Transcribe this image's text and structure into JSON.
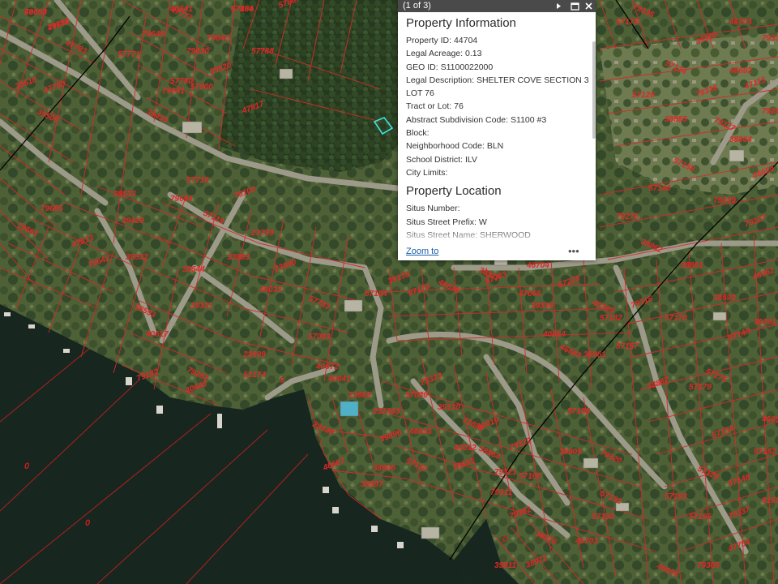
{
  "popup": {
    "pager": "(1 of 3)",
    "sections": [
      {
        "title": "Property Information",
        "rows": [
          {
            "label": "Property ID:",
            "value": "44704"
          },
          {
            "label": "Legal Acreage:",
            "value": "0.13"
          },
          {
            "label": "GEO ID:",
            "value": "S1100022000"
          },
          {
            "label": "Legal Description:",
            "value": "SHELTER COVE SECTION 3 LOT 76"
          },
          {
            "label": "Tract or Lot:",
            "value": "76"
          },
          {
            "label": "Abstract Subdivision Code:",
            "value": "S1100 #3"
          },
          {
            "label": "Block:",
            "value": ""
          },
          {
            "label": "Neighborhood Code:",
            "value": "BLN"
          },
          {
            "label": "School District:",
            "value": "ILV"
          },
          {
            "label": "City Limits:",
            "value": ""
          }
        ]
      },
      {
        "title": "Property Location",
        "rows": [
          {
            "label": "Situs Number:",
            "value": ""
          },
          {
            "label": "Situs Street Prefix:",
            "value": "W"
          },
          {
            "label": "Situs Street Name:",
            "value": "SHERWOOD"
          }
        ]
      }
    ],
    "zoom_label": "Zoom to",
    "more_label": "•••",
    "icons": [
      "next-icon",
      "maximize-icon",
      "close-icon"
    ]
  },
  "colors": {
    "parcel_line": "#d42a2a",
    "selection": "#3ee0e0",
    "popup_header": "#4a4a4a",
    "link": "#1a5fa8"
  },
  "parcel_labels": [
    "79650",
    "79634",
    "47777",
    "57886",
    "57887",
    "79649",
    "79640",
    "47783",
    "79430",
    "57788",
    "39510",
    "79641",
    "39509",
    "39520",
    "57771",
    "57780",
    "47780",
    "39439",
    "57900",
    "47817",
    "39420",
    "79694",
    "57119",
    "39533",
    "57716",
    "47813",
    "79685",
    "79661",
    "79642",
    "39532",
    "39544",
    "23690",
    "38593",
    "23799",
    "79100",
    "40617",
    "33893",
    "57783",
    "29311",
    "40033",
    "39138",
    "57184",
    "46638",
    "57179",
    "57083",
    "23699",
    "79282",
    "79283",
    "52174",
    "40640",
    "40672",
    "40041",
    "29130",
    "23665",
    "57040",
    "23323",
    "39130",
    "71883",
    "40019",
    "40012",
    "232363",
    "39896",
    "38864",
    "46653",
    "79322",
    "38905",
    "57185",
    "79320",
    "79321",
    "38906",
    "46667",
    "38897",
    "57130",
    "38891",
    "79311",
    "57165",
    "79392",
    "38976",
    "46703",
    "38972",
    "39811",
    "57130",
    "57192",
    "57193",
    "57195",
    "79337",
    "46704",
    "38911",
    "57723",
    "47066",
    "39336",
    "57228",
    "40289",
    "57182",
    "79315",
    "57170",
    "40054",
    "46683",
    "38961",
    "57157",
    "38867",
    "57179",
    "57275",
    "57140",
    "39261",
    "79209",
    "79227",
    "57158",
    "38864",
    "46654",
    "57140",
    "79276",
    "38862",
    "38861",
    "38593",
    "46961",
    "57126",
    "57124",
    "35900",
    "46703",
    "79339",
    "47115",
    "79335",
    "57175",
    "79336",
    "46692",
    "38885",
    "79227",
    "79263",
    "46695",
    "57154",
    "57157",
    "57129",
    "57148",
    "81635",
    "79365",
    "47754",
    "46656",
    "46653",
    "47758",
    "40641",
    "57164"
  ],
  "water_labels": [
    "0",
    "0",
    "0",
    "0"
  ]
}
